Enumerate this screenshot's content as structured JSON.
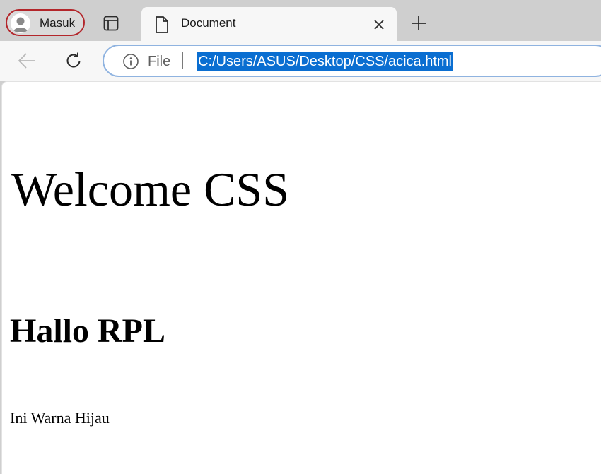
{
  "browser": {
    "profile": {
      "label": "Masuk",
      "icon": "person-icon",
      "border_color": "#b3262b"
    },
    "tab": {
      "title": "Document",
      "icon": "document-icon"
    },
    "address_bar": {
      "scheme_label": "File",
      "url": "C:/Users/ASUS/Desktop/CSS/acica.html",
      "selection_color": "#0a6ed1"
    }
  },
  "page": {
    "heading": "Welcome CSS",
    "subheading": "Hallo RPL",
    "paragraph": "Ini Warna Hijau"
  }
}
